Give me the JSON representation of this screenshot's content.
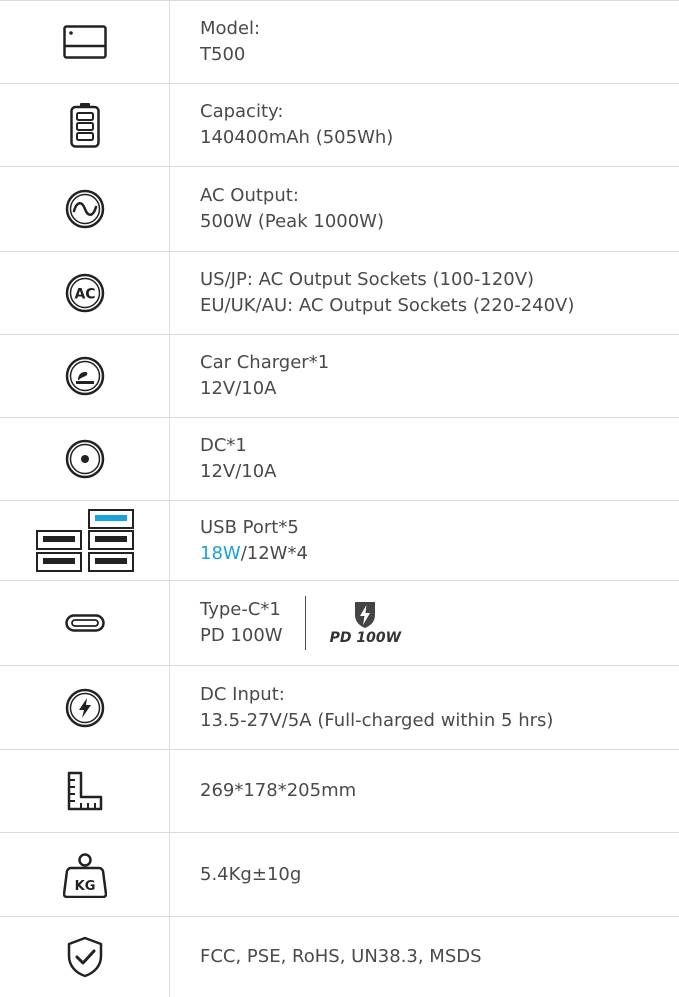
{
  "specs": [
    {
      "icon": "device-icon",
      "lines": [
        "Model:",
        "T500"
      ]
    },
    {
      "icon": "battery-icon",
      "lines": [
        "Capacity:",
        "140400mAh (505Wh)"
      ]
    },
    {
      "icon": "sine-wave-icon",
      "lines": [
        "AC Output:",
        "500W (Peak 1000W)"
      ]
    },
    {
      "icon": "ac-icon",
      "ac_label": "AC",
      "lines": [
        "US/JP: AC Output Sockets (100-120V)",
        "EU/UK/AU: AC Output Sockets (220-240V)"
      ]
    },
    {
      "icon": "car-charger-icon",
      "lines": [
        "Car Charger*1",
        "12V/10A"
      ]
    },
    {
      "icon": "dc-port-icon",
      "lines": [
        "DC*1",
        "12V/10A"
      ]
    },
    {
      "icon": "usb-ports-icon",
      "lines": [
        "USB Port*5"
      ],
      "usb_highlight": "18W",
      "usb_rest": "/12W*4"
    },
    {
      "icon": "type-c-icon",
      "lines": [
        "Type-C*1",
        "PD 100W"
      ],
      "pd_badge": "PD 100W"
    },
    {
      "icon": "dc-input-icon",
      "lines": [
        "DC Input:",
        "13.5-27V/5A (Full-charged within 5 hrs)"
      ]
    },
    {
      "icon": "ruler-icon",
      "lines": [
        "269*178*205mm"
      ]
    },
    {
      "icon": "weight-icon",
      "weight_label": "KG",
      "lines": [
        "5.4Kg±10g"
      ]
    },
    {
      "icon": "shield-check-icon",
      "lines": [
        "FCC, PSE, RoHS, UN38.3, MSDS"
      ]
    }
  ],
  "colors": {
    "text": "#4a4a4a",
    "accent": "#1aa3dc",
    "border": "#dcdcdc"
  }
}
